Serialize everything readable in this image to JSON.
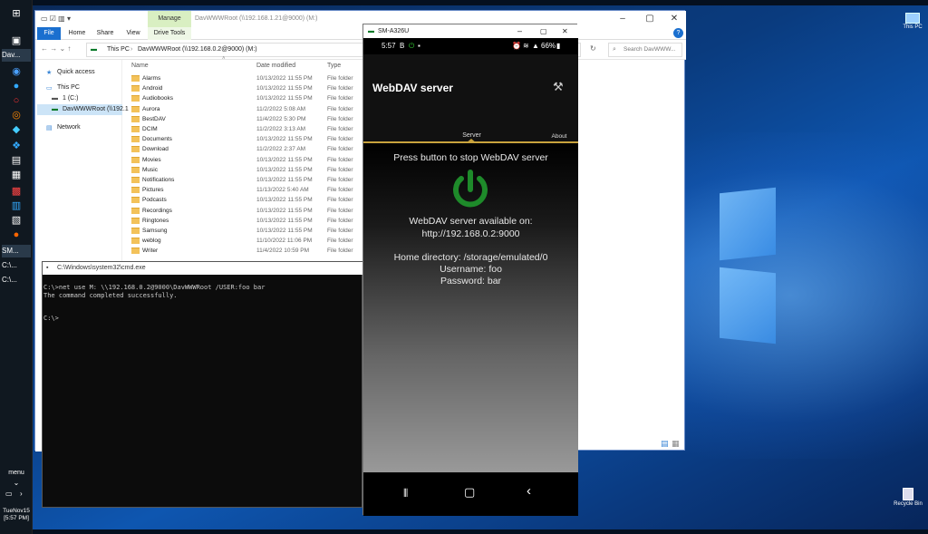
{
  "taskbar": {
    "tasks": [
      "Dav...",
      "SM...",
      "C:\\...",
      "C:\\..."
    ],
    "menu_label": "menu",
    "clock_date": "TueNov15",
    "clock_time": "[5:57 PM]"
  },
  "desktop_icons": {
    "this_pc": "This PC",
    "recycle_bin": "Recycle Bin"
  },
  "explorer": {
    "title": "DavWWWRoot (\\\\192.168.1.21@9000) (M:)",
    "ribbon_tabs": [
      "File",
      "Home",
      "Share",
      "View",
      "Drive Tools"
    ],
    "manage_label": "Manage",
    "breadcrumb_this_pc": "This PC",
    "breadcrumb_drive": "DavWWWRoot (\\\\192.168.0.2@9000) (M:)",
    "search_placeholder": "Search DavWWW...",
    "nav": {
      "quick_access": "Quick access",
      "this_pc": "This PC",
      "c_drive": "1 (C:)",
      "dav_drive": "DavWWWRoot (\\\\192.1",
      "network": "Network"
    },
    "columns": {
      "name": "Name",
      "date": "Date modified",
      "type": "Type"
    },
    "files": [
      {
        "name": "Alarms",
        "date": "10/13/2022 11:55 PM",
        "type": "File folder"
      },
      {
        "name": "Android",
        "date": "10/13/2022 11:55 PM",
        "type": "File folder"
      },
      {
        "name": "Audiobooks",
        "date": "10/13/2022 11:55 PM",
        "type": "File folder"
      },
      {
        "name": "Aurora",
        "date": "11/2/2022 5:08 AM",
        "type": "File folder"
      },
      {
        "name": "BestDAV",
        "date": "11/4/2022 5:30 PM",
        "type": "File folder"
      },
      {
        "name": "DCIM",
        "date": "11/2/2022 3:13 AM",
        "type": "File folder"
      },
      {
        "name": "Documents",
        "date": "10/13/2022 11:55 PM",
        "type": "File folder"
      },
      {
        "name": "Download",
        "date": "11/2/2022 2:37 AM",
        "type": "File folder"
      },
      {
        "name": "Movies",
        "date": "10/13/2022 11:55 PM",
        "type": "File folder"
      },
      {
        "name": "Music",
        "date": "10/13/2022 11:55 PM",
        "type": "File folder"
      },
      {
        "name": "Notifications",
        "date": "10/13/2022 11:55 PM",
        "type": "File folder"
      },
      {
        "name": "Pictures",
        "date": "11/13/2022 5:40 AM",
        "type": "File folder"
      },
      {
        "name": "Podcasts",
        "date": "10/13/2022 11:55 PM",
        "type": "File folder"
      },
      {
        "name": "Recordings",
        "date": "10/13/2022 11:55 PM",
        "type": "File folder"
      },
      {
        "name": "Ringtones",
        "date": "10/13/2022 11:55 PM",
        "type": "File folder"
      },
      {
        "name": "Samsung",
        "date": "10/13/2022 11:55 PM",
        "type": "File folder"
      },
      {
        "name": "weblog",
        "date": "11/10/2022 11:06 PM",
        "type": "File folder"
      },
      {
        "name": "Writer",
        "date": "11/4/2022 10:59 PM",
        "type": "File folder"
      }
    ]
  },
  "cmd": {
    "title": "C:\\Windows\\system32\\cmd.exe",
    "line1": "C:\\>net use M: \\\\192.168.0.2@9000\\DavWWWRoot /USER:foo bar",
    "line2": "The command completed successfully.",
    "line3": "C:\\>"
  },
  "phone": {
    "title": "SM-A326U",
    "status_time": "5:57",
    "status_b": "B",
    "battery": "66%",
    "app_title": "WebDAV server",
    "tab_server": "Server",
    "tab_about": "About",
    "press_button": "Press button to stop WebDAV server",
    "available_on": "WebDAV server available on:",
    "url": "http://192.168.0.2:9000",
    "home_dir": "Home directory: /storage/emulated/0",
    "username": "Username: foo",
    "password": "Password: bar"
  },
  "colors": {
    "accent_gold": "#c8a23c",
    "power_green": "#1e8a2a",
    "manage_tab": "#d9efc2"
  }
}
